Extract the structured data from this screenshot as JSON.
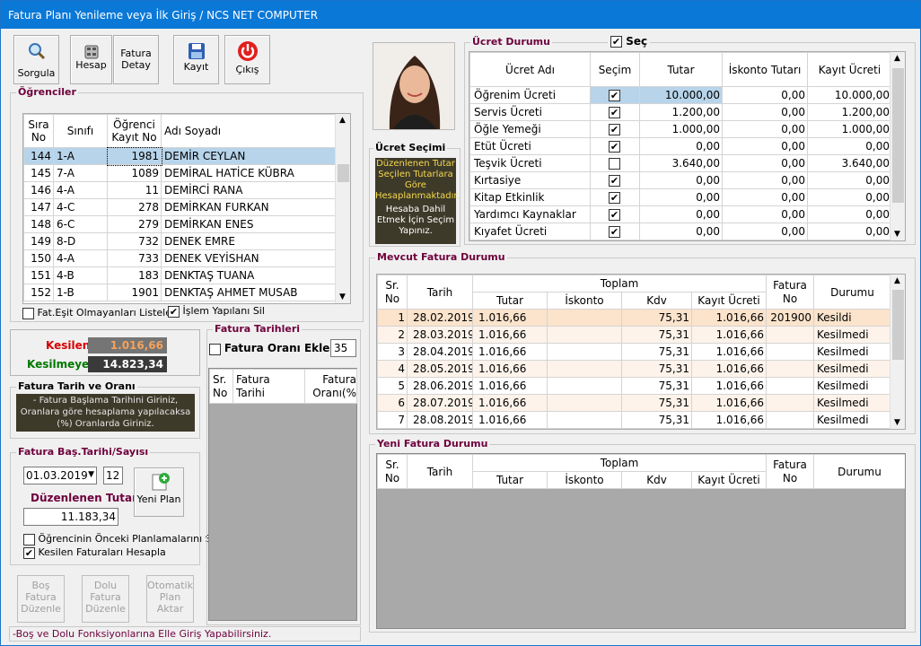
{
  "window_title": "Fatura Planı Yenileme veya İlk Giriş / NCS NET COMPUTER",
  "toolbar": {
    "sorgula": "Sorgula",
    "hesap": "Hesap",
    "fatura_detay_1": "Fatura",
    "fatura_detay_2": "Detay",
    "kayit": "Kayıt",
    "cikis": "Çıkış"
  },
  "ogrenciler": {
    "title": "Öğrenciler",
    "headers": {
      "sira1": "Sıra",
      "sira2": "No",
      "sinif": "Sınıfı",
      "kayit1": "Öğrenci",
      "kayit2": "Kayıt No",
      "ad": "Adı Soyadı"
    },
    "rows": [
      {
        "no": "144",
        "sinif": "1-A",
        "kayit": "1981",
        "ad": "DEMİR CEYLAN"
      },
      {
        "no": "145",
        "sinif": "7-A",
        "kayit": "1089",
        "ad": "DEMİRAL HATİCE KÜBRA"
      },
      {
        "no": "146",
        "sinif": "4-A",
        "kayit": "11",
        "ad": "DEMİRCİ RANA"
      },
      {
        "no": "147",
        "sinif": "4-C",
        "kayit": "278",
        "ad": "DEMİRKAN FURKAN"
      },
      {
        "no": "148",
        "sinif": "6-C",
        "kayit": "279",
        "ad": "DEMİRKAN ENES"
      },
      {
        "no": "149",
        "sinif": "8-D",
        "kayit": "732",
        "ad": "DENEK EMRE"
      },
      {
        "no": "150",
        "sinif": "4-A",
        "kayit": "733",
        "ad": "DENEK VEYİSHAN"
      },
      {
        "no": "151",
        "sinif": "4-B",
        "kayit": "183",
        "ad": "DENKTAŞ TUANA"
      },
      {
        "no": "152",
        "sinif": "1-B",
        "kayit": "1901",
        "ad": "DENKTAŞ AHMET MUSAB"
      }
    ],
    "chk_fat": "Fat.Eşit Olmayanları Listele",
    "chk_islem": "İşlem Yapılanı Sil"
  },
  "summary": {
    "kesilen_label": "Kesilen",
    "kesilen_value": "1.016,66",
    "kesilmeyen_label": "Kesilmeyen",
    "kesilmeyen_value": "14.823,34"
  },
  "fatura_tarih_orani": {
    "title": "Fatura Tarih ve Oranı",
    "info": "- Fatura Başlama Tarihini Giriniz, Oranlara göre hesaplama yapılacaksa (%) Oranlarda Giriniz."
  },
  "fatura_bas": {
    "title": "Fatura Baş.Tarihi/Sayısı",
    "date": "01.03.2019",
    "count": "12",
    "duzenlenen_label": "Düzenlenen Tutar",
    "duzenlenen_value": "11.183,34",
    "yeni_plan": "Yeni Plan",
    "chk1": "Öğrencinin Önceki Planlamalarını Sil",
    "chk2": "Kesilen Faturaları Hesapla"
  },
  "bottom_buttons": {
    "bos1": "Boş",
    "bos2": "Fatura",
    "bos3": "Düzenle",
    "dolu1": "Dolu",
    "dolu2": "Fatura",
    "dolu3": "Düzenle",
    "oto1": "Otomatik",
    "oto2": "Plan",
    "oto3": "Aktar"
  },
  "status_text": "-Boş ve Dolu Fonksiyonlarına Elle Giriş Yapabilirsiniz.",
  "fatura_tarihleri": {
    "title": "Fatura Tarihleri",
    "chk": "Fatura Oranı Ekle",
    "oran": "35",
    "h_sr1": "Sr.",
    "h_sr2": "No",
    "h_ft1": "Fatura",
    "h_ft2": "Tarihi",
    "h_fo1": "Fatura",
    "h_fo2": "Oranı(%"
  },
  "ucret_secimi": {
    "title": "Ücret Seçimi",
    "msg1": "Düzenlenen Tutar Seçilen Tutarlara Göre Hesaplanmaktadır.",
    "msg2": "Hesaba Dahil Etmek İçin Seçim Yapınız."
  },
  "ucret_durumu": {
    "title": "Ücret Durumu",
    "sec": "Seç",
    "headers": {
      "adi": "Ücret Adı",
      "secim": "Seçim",
      "tutar": "Tutar",
      "iskonto": "İskonto Tutarı",
      "kayit": "Kayıt Ücreti"
    },
    "rows": [
      {
        "adi": "Öğrenim Ücreti",
        "secim": true,
        "tutar": "10.000,00",
        "iskonto": "0,00",
        "kayit": "10.000,00"
      },
      {
        "adi": "Servis Ücreti",
        "secim": true,
        "tutar": "1.200,00",
        "iskonto": "0,00",
        "kayit": "1.200,00"
      },
      {
        "adi": "Öğle Yemeği",
        "secim": true,
        "tutar": "1.000,00",
        "iskonto": "0,00",
        "kayit": "1.000,00"
      },
      {
        "adi": "Etüt Ücreti",
        "secim": true,
        "tutar": "0,00",
        "iskonto": "0,00",
        "kayit": "0,00"
      },
      {
        "adi": "Teşvik Ücreti",
        "secim": false,
        "tutar": "3.640,00",
        "iskonto": "0,00",
        "kayit": "3.640,00"
      },
      {
        "adi": "Kırtasiye",
        "secim": true,
        "tutar": "0,00",
        "iskonto": "0,00",
        "kayit": "0,00"
      },
      {
        "adi": "Kitap Etkinlik",
        "secim": true,
        "tutar": "0,00",
        "iskonto": "0,00",
        "kayit": "0,00"
      },
      {
        "adi": "Yardımcı Kaynaklar",
        "secim": true,
        "tutar": "0,00",
        "iskonto": "0,00",
        "kayit": "0,00"
      },
      {
        "adi": "Kıyafet Ücreti",
        "secim": true,
        "tutar": "0,00",
        "iskonto": "0,00",
        "kayit": "0,00"
      }
    ]
  },
  "mevcut": {
    "title": "Mevcut Fatura Durumu",
    "headers": {
      "sr1": "Sr.",
      "sr2": "No",
      "tarih": "Tarih",
      "toplam": "Toplam",
      "tutar": "Tutar",
      "iskonto": "İskonto",
      "kdv": "Kdv",
      "kayit": "Kayıt Ücreti",
      "fno1": "Fatura",
      "fno2": "No",
      "durum": "Durumu"
    },
    "rows": [
      {
        "sr": "1",
        "tarih": "28.02.2019",
        "tutar": "1.016,66",
        "iskonto": "",
        "kdv": "75,31",
        "kayit": "1.016,66",
        "fno": "201900",
        "durum": "Kesildi"
      },
      {
        "sr": "2",
        "tarih": "28.03.2019",
        "tutar": "1.016,66",
        "iskonto": "",
        "kdv": "75,31",
        "kayit": "1.016,66",
        "fno": "",
        "durum": "Kesilmedi"
      },
      {
        "sr": "3",
        "tarih": "28.04.2019",
        "tutar": "1.016,66",
        "iskonto": "",
        "kdv": "75,31",
        "kayit": "1.016,66",
        "fno": "",
        "durum": "Kesilmedi"
      },
      {
        "sr": "4",
        "tarih": "28.05.2019",
        "tutar": "1.016,66",
        "iskonto": "",
        "kdv": "75,31",
        "kayit": "1.016,66",
        "fno": "",
        "durum": "Kesilmedi"
      },
      {
        "sr": "5",
        "tarih": "28.06.2019",
        "tutar": "1.016,66",
        "iskonto": "",
        "kdv": "75,31",
        "kayit": "1.016,66",
        "fno": "",
        "durum": "Kesilmedi"
      },
      {
        "sr": "6",
        "tarih": "28.07.2019",
        "tutar": "1.016,66",
        "iskonto": "",
        "kdv": "75,31",
        "kayit": "1.016,66",
        "fno": "",
        "durum": "Kesilmedi"
      },
      {
        "sr": "7",
        "tarih": "28.08.2019",
        "tutar": "1.016,66",
        "iskonto": "",
        "kdv": "75,31",
        "kayit": "1.016,66",
        "fno": "",
        "durum": "Kesilmedi"
      }
    ]
  },
  "yeni": {
    "title": "Yeni Fatura Durumu",
    "headers": {
      "sr1": "Sr.",
      "sr2": "No",
      "tarih": "Tarih",
      "toplam": "Toplam",
      "tutar": "Tutar",
      "iskonto": "İskonto",
      "kdv": "Kdv",
      "kayit": "Kayıt Ücreti",
      "fno1": "Fatura",
      "fno2": "No",
      "durum": "Durumu"
    }
  },
  "colors": {
    "title_bar": "#0a78d7",
    "selected_row": "#b7d4ea",
    "kesildi_row": "#fbe3cc",
    "group_title": "#6e003c"
  }
}
